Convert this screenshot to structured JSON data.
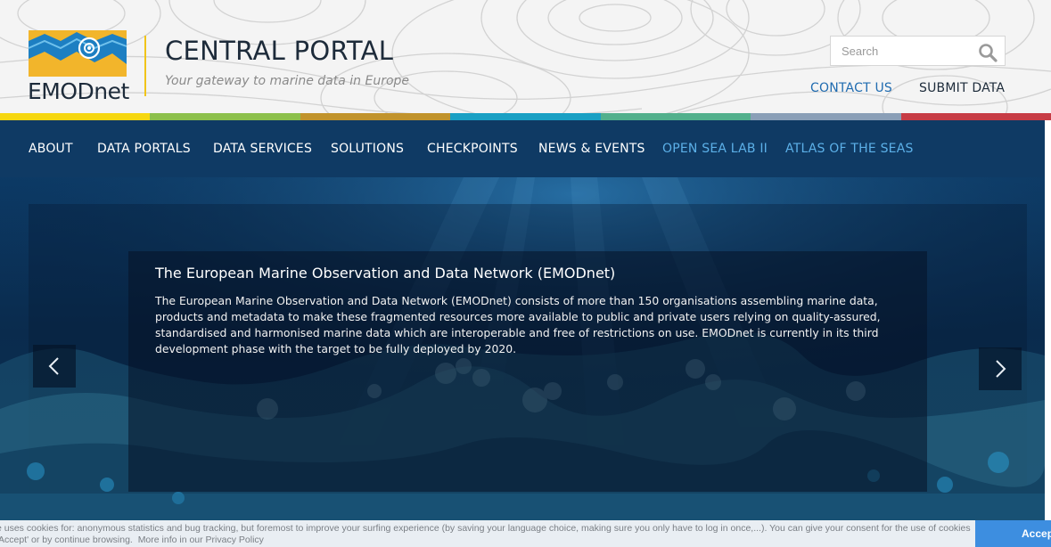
{
  "header": {
    "logo_text": "EMODnet",
    "title": "CENTRAL PORTAL",
    "tagline": "Your gateway to marine data in Europe",
    "search_placeholder": "Search",
    "contact_label": "CONTACT US",
    "submit_label": "SUBMIT DATA"
  },
  "color_stripes": [
    "#f6d70f",
    "#8cc04b",
    "#c1932c",
    "#1aa0c4",
    "#52b08c",
    "#8a9fb7",
    "#c73c45"
  ],
  "nav": {
    "items": [
      {
        "label": "ABOUT"
      },
      {
        "label": "DATA PORTALS"
      },
      {
        "label": "DATA SERVICES"
      },
      {
        "label": "SOLUTIONS"
      },
      {
        "label": "CHECKPOINTS"
      },
      {
        "label": "NEWS & EVENTS"
      },
      {
        "label": "OPEN SEA LAB II"
      },
      {
        "label": "ATLAS OF THE SEAS"
      }
    ]
  },
  "hero": {
    "title": "The European Marine Observation and Data Network (EMODnet)",
    "body": "The European Marine Observation and Data Network (EMODnet) consists of more than 150 organisations assembling marine data, products and metadata to make these fragmented resources more available to public and private users relying on quality-assured, standardised and harmonised marine data which are interoperable and free of restrictions on use. EMODnet is currently in its third development phase with the target to be fully deployed by 2020.",
    "prev_icon": "chevron-left-icon",
    "next_icon": "chevron-right-icon"
  },
  "cookie": {
    "line1": "e uses cookies for: anonymous statistics and bug tracking, but foremost to improve your surfing experience (by saving your language choice, making sure you only have to log in once,...). You can give your consent for the use of cookies",
    "line2": "'Accept' or by continue browsing.",
    "link": "More info in our Privacy Policy",
    "accept_label": "Accept"
  }
}
